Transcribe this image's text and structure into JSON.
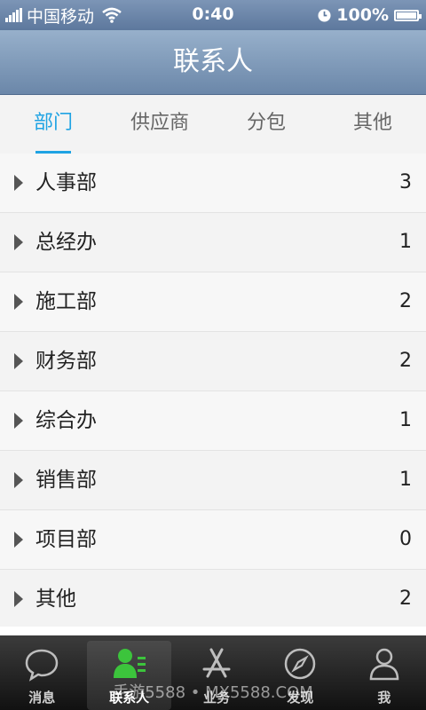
{
  "status_bar": {
    "carrier": "中国移动",
    "time": "0:40",
    "battery": "100%"
  },
  "nav": {
    "title": "联系人"
  },
  "tabs": [
    {
      "label": "部门",
      "active": true
    },
    {
      "label": "供应商",
      "active": false
    },
    {
      "label": "分包",
      "active": false
    },
    {
      "label": "其他",
      "active": false
    }
  ],
  "departments": [
    {
      "name": "人事部",
      "count": "3"
    },
    {
      "name": "总经办",
      "count": "1"
    },
    {
      "name": "施工部",
      "count": "2"
    },
    {
      "name": "财务部",
      "count": "2"
    },
    {
      "name": "综合办",
      "count": "1"
    },
    {
      "name": "销售部",
      "count": "1"
    },
    {
      "name": "项目部",
      "count": "0"
    },
    {
      "name": "其他",
      "count": "2"
    }
  ],
  "tabbar": [
    {
      "label": "消息",
      "icon": "chat-bubble-icon"
    },
    {
      "label": "联系人",
      "icon": "contacts-icon",
      "active": true
    },
    {
      "label": "业务",
      "icon": "app-store-icon"
    },
    {
      "label": "发现",
      "icon": "compass-icon"
    },
    {
      "label": "我",
      "icon": "person-icon"
    }
  ],
  "watermark": "手游5588 • MX5588.COM",
  "colors": {
    "accent": "#1fa3e3",
    "active_icon": "#3cc43c"
  }
}
